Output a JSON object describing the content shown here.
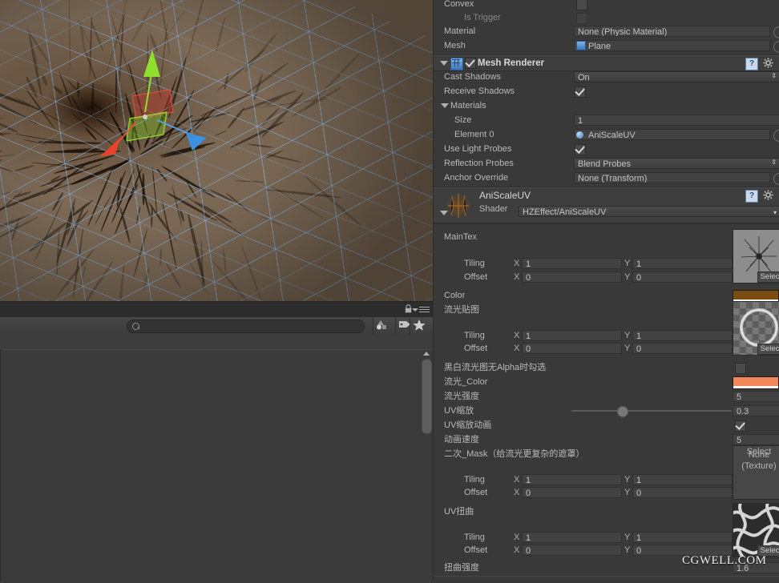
{
  "scene": {
    "name": "scene-view",
    "gizmo": "move-tool",
    "axis_colors": {
      "x": "#e8432a",
      "y": "#7ed321",
      "z": "#3d8fe0"
    },
    "grid_color": "#82afe1",
    "ground_color": "#7b6a58"
  },
  "project_panel": {
    "search": {
      "value": "",
      "placeholder": ""
    },
    "filters": [
      "type-filter-icon",
      "label-filter-icon",
      "favorite-filter-icon"
    ],
    "lock_icon": "lock-icon",
    "menu_icon": "hamburger-menu-icon"
  },
  "inspector": {
    "collider": {
      "rows": [
        {
          "label": "Convex",
          "type": "checkbox",
          "checked": false,
          "disabled": false
        },
        {
          "label": "Is Trigger",
          "type": "checkbox",
          "checked": false,
          "disabled": true
        },
        {
          "label": "Material",
          "type": "object",
          "value": "None (Physic Material)"
        },
        {
          "label": "Mesh",
          "type": "object",
          "value": "Plane"
        }
      ]
    },
    "mesh_renderer": {
      "title": "Mesh Renderer",
      "enabled": true,
      "icon": "mesh-renderer-icon",
      "help_icon": "help-icon",
      "gear_icon": "gear-icon",
      "rows": [
        {
          "label": "Cast Shadows",
          "type": "popup",
          "value": "On"
        },
        {
          "label": "Receive Shadows",
          "type": "checkbox",
          "checked": true
        },
        {
          "label": "Materials",
          "type": "foldout"
        },
        {
          "label": "Size",
          "type": "text",
          "value": "1"
        },
        {
          "label": "Element 0",
          "type": "object",
          "value": "AniScaleUV"
        },
        {
          "label": "Use Light Probes",
          "type": "checkbox",
          "checked": true
        },
        {
          "label": "Reflection Probes",
          "type": "popup",
          "value": "Blend Probes"
        },
        {
          "label": "Anchor Override",
          "type": "object",
          "value": "None (Transform)"
        }
      ]
    },
    "material": {
      "name": "AniScaleUV",
      "shader_label": "Shader",
      "shader_value": "HZEffect/AniScaleUV",
      "help_icon": "help-icon",
      "gear_icon": "gear-icon",
      "props": {
        "maintex_label": "MainTex",
        "maintex_tiling_label": "Tiling",
        "maintex_offset_label": "Offset",
        "maintex_tiling_x": "1",
        "maintex_tiling_y": "1",
        "maintex_offset_x": "0",
        "maintex_offset_y": "0",
        "maintex_select": "Select",
        "color_label": "Color",
        "color_value": "#7a4c10",
        "flow_tex_label": "流光贴图",
        "flow_tiling_label": "Tiling",
        "flow_offset_label": "Offset",
        "flow_tiling_x": "1",
        "flow_tiling_y": "1",
        "flow_offset_x": "0",
        "flow_offset_y": "0",
        "flow_select": "Select",
        "alpha_toggle_label": "黑白流光图无Alpha时勾选",
        "alpha_toggle_checked": false,
        "flow_color_label": "流光_Color",
        "flow_color_value": "#f2875a",
        "flow_intensity_label": "流光强度",
        "flow_intensity_value": "5",
        "uv_scale_label": "UV缩放",
        "uv_scale_value": "0.3",
        "uv_scale_anim_label": "UV缩放动画",
        "uv_scale_anim_checked": true,
        "anim_speed_label": "动画速度",
        "anim_speed_value": "5",
        "mask_label": "二次_Mask（给流光更复杂的遮罩）",
        "mask_none_line1": "None",
        "mask_none_line2": "(Texture)",
        "mask_tiling_label": "Tiling",
        "mask_offset_label": "Offset",
        "mask_tiling_x": "1",
        "mask_tiling_y": "1",
        "mask_offset_x": "0",
        "mask_offset_y": "0",
        "mask_select": "Select",
        "uv_distort_label": "UV扭曲",
        "distort_tiling_label": "Tiling",
        "distort_offset_label": "Offset",
        "distort_tiling_x": "1",
        "distort_tiling_y": "1",
        "distort_offset_x": "0",
        "distort_offset_y": "0",
        "distort_select": "Select",
        "distort_strength_label": "扭曲强度",
        "distort_strength_value": "1.6",
        "axis_x": "X",
        "axis_y": "Y"
      }
    }
  },
  "watermark": "CGWELL.COM"
}
